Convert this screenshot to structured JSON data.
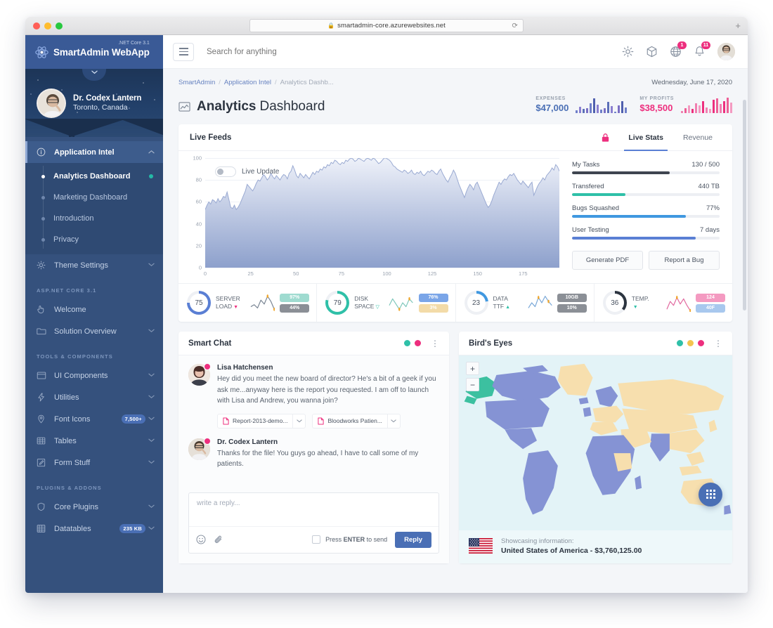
{
  "browser": {
    "url": "smartadmin-core.azurewebsites.net",
    "lock_glyph": "🔒",
    "reload_glyph": "⟳",
    "newtab_glyph": "+"
  },
  "sidebar": {
    "brand": {
      "name": "SmartAdmin WebApp",
      "sup": ".NET Core 3.1"
    },
    "profile": {
      "name": "Dr. Codex Lantern",
      "location": "Toronto, Canada"
    },
    "nav": [
      {
        "label": "Application Intel",
        "icon": "info-icon",
        "active": true,
        "caret": true
      },
      {
        "label": "Theme Settings",
        "icon": "gear-icon",
        "caret": true
      }
    ],
    "submenu": [
      {
        "label": "Analytics Dashboard",
        "active": true,
        "dot": true
      },
      {
        "label": "Marketing Dashboard"
      },
      {
        "label": "Introduction"
      },
      {
        "label": "Privacy"
      }
    ],
    "section_aspnet": "ASP.NET CORE 3.1",
    "aspnet_items": [
      {
        "label": "Welcome",
        "icon": "hand-icon"
      },
      {
        "label": "Solution Overview",
        "icon": "folder-icon",
        "caret": true
      }
    ],
    "section_tools": "TOOLS & COMPONENTS",
    "tools_items": [
      {
        "label": "UI Components",
        "icon": "window-icon",
        "caret": true
      },
      {
        "label": "Utilities",
        "icon": "bolt-icon",
        "caret": true
      },
      {
        "label": "Font Icons",
        "icon": "pin-icon",
        "badge": "7,500+",
        "caret": true
      },
      {
        "label": "Tables",
        "icon": "table-icon",
        "caret": true
      },
      {
        "label": "Form Stuff",
        "icon": "pencil-icon",
        "caret": true
      }
    ],
    "section_plugins": "PLUGINS & ADDONS",
    "plugins_items": [
      {
        "label": "Core Plugins",
        "icon": "shield-icon",
        "caret": true
      },
      {
        "label": "Datatables",
        "icon": "grid-icon",
        "badge": "235 KB",
        "caret": true
      }
    ]
  },
  "topbar": {
    "search_placeholder": "Search for anything",
    "icons": [
      {
        "name": "gear-icon"
      },
      {
        "name": "cube-icon"
      },
      {
        "name": "globe-icon",
        "badge": "1"
      },
      {
        "name": "bell-icon",
        "badge": "11"
      }
    ]
  },
  "page": {
    "breadcrumb": [
      "SmartAdmin",
      "Application Intel",
      "Analytics Dashb..."
    ],
    "date": "Wednesday, June 17, 2020",
    "title_bold": "Analytics",
    "title_light": "Dashboard",
    "head_stats": [
      {
        "label": "EXPENSES",
        "value": "$47,000",
        "color": "#4a6fb5"
      },
      {
        "label": "MY PROFITS",
        "value": "$38,500",
        "color": "#ed2f7e"
      }
    ]
  },
  "live_feeds": {
    "title": "Live Feeds",
    "lock_icon": "lock-icon",
    "tabs": [
      {
        "label": "Live Stats",
        "active": true
      },
      {
        "label": "Revenue",
        "active": false
      }
    ],
    "live_update_label": "Live Update",
    "stats": [
      {
        "name": "My Tasks",
        "value": "130 / 500",
        "pct": 66,
        "color": "#3f4550"
      },
      {
        "name": "Transfered",
        "value": "440 TB",
        "pct": 36,
        "color": "#2fc0a8"
      },
      {
        "name": "Bugs Squashed",
        "value": "77%",
        "pct": 77,
        "color": "#4098e0"
      },
      {
        "name": "User Testing",
        "value": "7 days",
        "pct": 84,
        "color": "#5a7fd4"
      }
    ],
    "buttons": [
      {
        "label": "Generate PDF"
      },
      {
        "label": "Report a Bug"
      }
    ],
    "metrics": [
      {
        "value": "75",
        "label_line1": "SERVER",
        "label_line2": "LOAD",
        "ring": "#5a7fd4",
        "ring_pct": 75,
        "trend": "down",
        "trend_color": "#ed2f7e",
        "spark_color": "#7a8694",
        "badges": [
          {
            "text": "97%",
            "bg": "#9fdbd0",
            "fg": "#ffffff"
          },
          {
            "text": "44%",
            "bg": "#8b8f96",
            "fg": "#ffffff"
          }
        ]
      },
      {
        "value": "79",
        "label_line1": "DISK",
        "label_line2": "SPACE",
        "ring": "#2fc0a8",
        "ring_pct": 79,
        "trend": "flat",
        "trend_color": "#2fc0a8",
        "spark_color": "#7fc8bb",
        "badges": [
          {
            "text": "76%",
            "bg": "#7aa5e8",
            "fg": "#ffffff"
          },
          {
            "text": "3%",
            "bg": "#f3dba8",
            "fg": "#ffffff"
          }
        ]
      },
      {
        "value": "23",
        "label_line1": "DATA",
        "label_line2": "TTF",
        "ring": "#4098e0",
        "ring_pct": 23,
        "trend": "up",
        "trend_color": "#2fc0a8",
        "spark_color": "#7aa8d8",
        "badges": [
          {
            "text": "10GB",
            "bg": "#8b8f96",
            "fg": "#ffffff"
          },
          {
            "text": "10%",
            "bg": "#8b8f96",
            "fg": "#ffffff"
          }
        ]
      },
      {
        "value": "36",
        "label_line1": "TEMP.",
        "label_line2": "",
        "ring": "#2c3440",
        "ring_pct": 36,
        "trend": "down",
        "trend_color": "#2fc0a8",
        "spark_color": "#e26aa0",
        "badges": [
          {
            "text": "124",
            "bg": "#f49ac1",
            "fg": "#ffffff"
          },
          {
            "text": "40F",
            "bg": "#a8c8ee",
            "fg": "#ffffff"
          }
        ]
      }
    ]
  },
  "chart_data": {
    "type": "area",
    "title": "Live Feeds",
    "xlabel": "",
    "ylabel": "",
    "xlim": [
      0,
      195
    ],
    "ylim": [
      0,
      100
    ],
    "xticks": [
      0,
      25,
      50,
      75,
      100,
      125,
      150,
      175
    ],
    "yticks": [
      0,
      20,
      40,
      60,
      80,
      100
    ],
    "grid": true,
    "legend": "none",
    "series": [
      {
        "name": "Live Feed",
        "values": [
          53,
          57,
          60,
          58,
          62,
          61,
          59,
          63,
          60,
          62,
          65,
          64,
          69,
          62,
          55,
          54,
          57,
          53,
          55,
          58,
          62,
          66,
          70,
          76,
          74,
          72,
          70,
          73,
          77,
          80,
          79,
          82,
          85,
          83,
          80,
          82,
          86,
          83,
          81,
          84,
          82,
          80,
          83,
          85,
          84,
          81,
          86,
          88,
          93,
          89,
          84,
          82,
          86,
          84,
          82,
          85,
          83,
          81,
          84,
          87,
          85,
          88,
          87,
          90,
          89,
          92,
          91,
          94,
          93,
          96,
          95,
          98,
          97,
          95,
          94,
          96,
          95,
          98,
          97,
          99,
          100,
          99,
          97,
          98,
          100,
          99,
          98,
          97,
          99,
          100,
          99,
          98,
          100,
          99,
          97,
          95,
          96,
          98,
          100,
          100,
          99,
          98,
          96,
          93,
          92,
          90,
          89,
          88,
          87,
          89,
          88,
          86,
          87,
          89,
          86,
          85,
          87,
          86,
          88,
          85,
          84,
          86,
          88,
          87,
          89,
          88,
          86,
          85,
          88,
          90,
          86,
          83,
          80,
          78,
          82,
          85,
          89,
          86,
          81,
          76,
          72,
          68,
          64,
          69,
          73,
          76,
          74,
          71,
          76,
          78,
          74,
          70,
          66,
          62,
          58,
          55,
          57,
          61,
          66,
          70,
          74,
          78,
          76,
          79,
          81,
          80,
          83,
          85,
          84,
          86,
          83,
          80,
          78,
          76,
          79,
          77,
          75,
          73,
          76,
          78,
          66,
          70,
          74,
          77,
          79,
          82,
          80,
          84,
          86,
          88,
          91,
          89,
          94,
          92,
          88
        ]
      }
    ]
  },
  "smart_chat": {
    "title": "Smart Chat",
    "dots": [
      "#2fc0a8",
      "#ed2f7e"
    ],
    "messages": [
      {
        "name": "Lisa Hatchensen",
        "text": "Hey did you meet the new board of director? He's a bit of a geek if you ask me...anyway here is the report you requested. I am off to launch with Lisa and Andrew, you wanna join?",
        "attachments": [
          {
            "name": "Report-2013-demo..."
          },
          {
            "name": "Bloodworks Patien..."
          }
        ]
      },
      {
        "name": "Dr. Codex Lantern",
        "text": "Thanks for the file! You guys go ahead, I have to call some of my patients.",
        "attachments": []
      }
    ],
    "reply_placeholder": "write a reply...",
    "enter_prefix": "Press ",
    "enter_bold": "ENTER",
    "enter_suffix": " to send",
    "reply_button": "Reply"
  },
  "birds_eyes": {
    "title": "Bird's Eyes",
    "dots": [
      "#2fc0a8",
      "#f3c44e",
      "#ed2f7e"
    ],
    "zoom_in": "+",
    "zoom_out": "−",
    "footer_sub": "Showcasing information:",
    "footer_main": "United States of America - $3,760,125.00"
  }
}
